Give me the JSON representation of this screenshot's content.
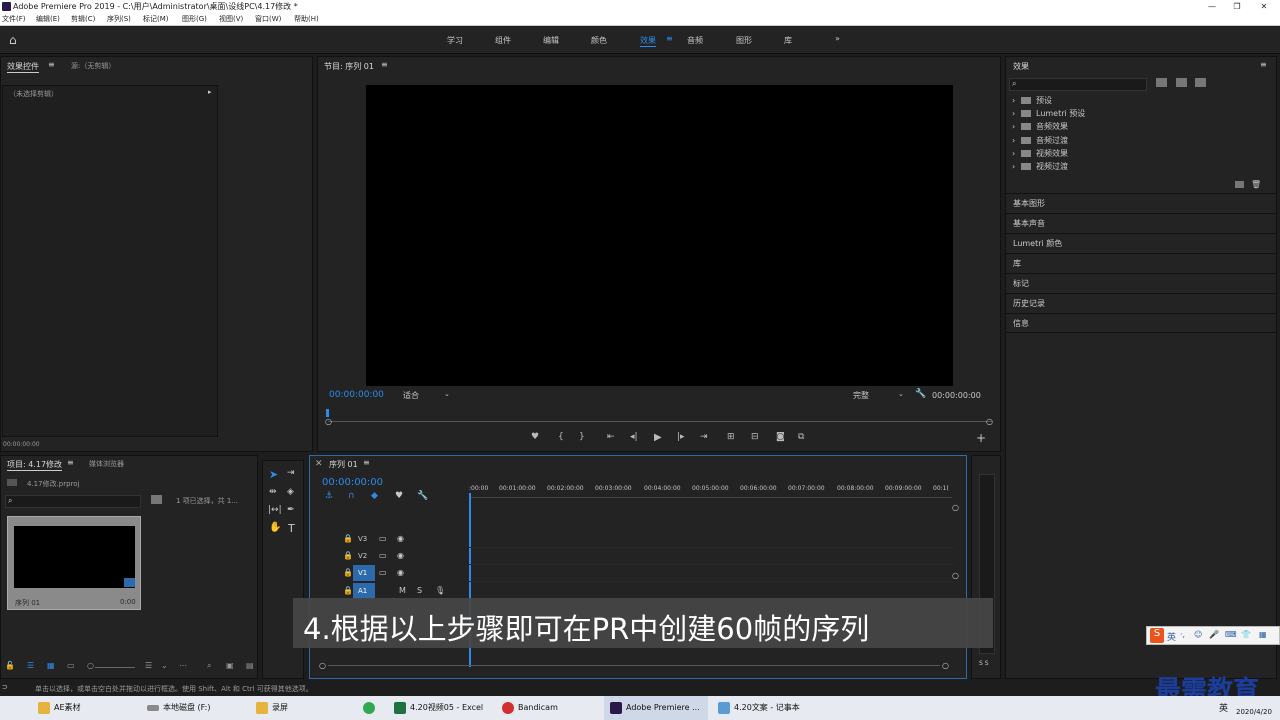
{
  "window": {
    "title": "Adobe Premiere Pro 2019 - C:\\用户\\Administrator\\桌面\\设线PC\\4.17修改 *"
  },
  "menu": [
    "文件(F)",
    "编辑(E)",
    "剪辑(C)",
    "序列(S)",
    "标记(M)",
    "图形(G)",
    "视图(V)",
    "窗口(W)",
    "帮助(H)"
  ],
  "workspaces": [
    "学习",
    "组件",
    "编辑",
    "颜色",
    "效果",
    "音频",
    "图形",
    "库"
  ],
  "active_workspace": "效果",
  "effect_controls": {
    "tab1": "效果控件",
    "tab2": "源:（无剪辑）",
    "no_clip": "（未选择剪辑）",
    "timecode": "00:00:00:00"
  },
  "program": {
    "title": "节目: 序列 01",
    "timecode_left": "00:00:00:00",
    "fit": "适合",
    "quality": "完整",
    "timecode_right": "00:00:00:00"
  },
  "project": {
    "tab1": "项目: 4.17修改",
    "tab2": "媒体浏览器",
    "file": "4.17修改.prproj",
    "selection": "1 项已选择，共 1...",
    "item_name": "序列 01",
    "item_duration": "0:00"
  },
  "timeline": {
    "tab": "序列 01",
    "timecode": "00:00:00:00",
    "ruler": [
      ":00:00",
      "00:01:00:00",
      "00:02:00:00",
      "00:03:00:00",
      "00:04:00:00",
      "00:05:00:00",
      "00:06:00:00",
      "00:07:00:00",
      "00:08:00:00",
      "00:09:00:00",
      "00:1("
    ],
    "tracks": [
      "V3",
      "V2",
      "V1",
      "A1"
    ]
  },
  "effects_panel": {
    "title": "效果",
    "folders": [
      "预设",
      "Lumetri 预设",
      "音频效果",
      "音频过渡",
      "视频效果",
      "视频过渡"
    ],
    "sections": [
      "基本图形",
      "基本声音",
      "Lumetri 颜色",
      "库",
      "标记",
      "历史记录",
      "信息"
    ]
  },
  "status": {
    "hint": "单击以选择，或单击空白处并拖动以进行框选。使用 Shift、Alt 和 Ctrl 可获得其他选项。"
  },
  "caption": "4.根据以上步骤即可在PR中创建60帧的序列",
  "watermark": "最需教育",
  "audio_meter": "S S",
  "taskbar": {
    "items": [
      "AE素材",
      "本地磁盘 (F:)",
      "录屏",
      "4.20视频05 - Excel",
      "Bandicam",
      "Adobe Premiere ...",
      "4.20文案 - 记事本"
    ],
    "ime": "英",
    "tray_ime": "英",
    "date": "2020/4/20"
  },
  "colors": {
    "accent": "#2d8ceb",
    "panel": "#232323",
    "bg": "#1d1d1d"
  }
}
